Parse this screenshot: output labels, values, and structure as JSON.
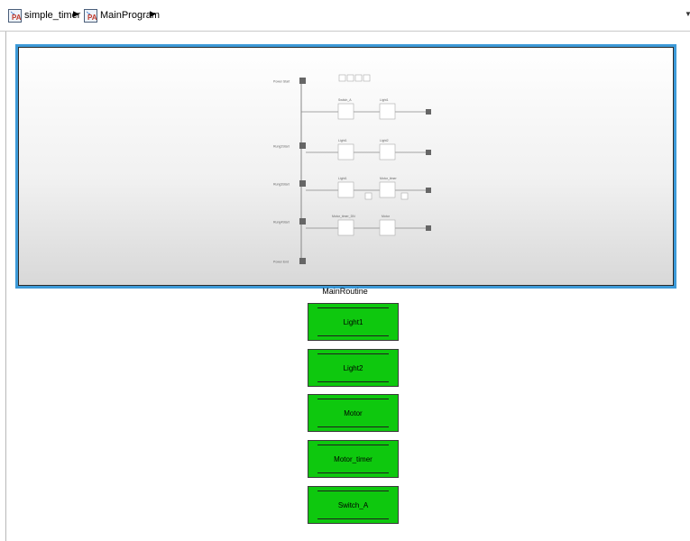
{
  "breadcrumb": {
    "items": [
      {
        "label": "simple_timer",
        "icon": "model-icon"
      },
      {
        "label": "MainProgram",
        "icon": "program-icon"
      }
    ],
    "separator": "▶",
    "dropdown": "▼"
  },
  "routine": {
    "label": "MainRoutine",
    "ladder": {
      "power_start": "Power Start",
      "power_end": "Power End",
      "rungs": [
        {
          "start": "",
          "elements": [
            "Switch_A",
            "Light1"
          ]
        },
        {
          "start": "Rung2Start",
          "elements": [
            "Light1",
            "Light2"
          ]
        },
        {
          "start": "Rung3Start",
          "elements": [
            "Light1",
            "Motor_timer"
          ]
        },
        {
          "start": "Rung4Start",
          "elements": [
            "Motor_timer_DN",
            "Motor"
          ]
        }
      ]
    }
  },
  "blocks": [
    "Light1",
    "Light2",
    "Motor",
    "Motor_timer",
    "Switch_A"
  ],
  "colors": {
    "block_fill": "#0ec80e",
    "selection_border": "#3d9ad8"
  }
}
